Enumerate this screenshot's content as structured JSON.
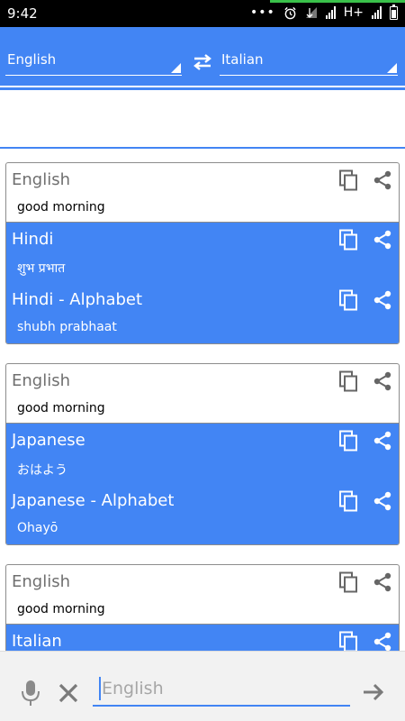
{
  "status_bar": {
    "time": "9:42",
    "network": "H+",
    "icons": [
      "dots-icon",
      "alarm-icon",
      "signal-off-icon",
      "signal-icon",
      "signal-icon",
      "battery-icon"
    ]
  },
  "colors": {
    "accent": "#4285f4",
    "status_bar": "#000000",
    "progress": "#3ac14a"
  },
  "header": {
    "source_language": "English",
    "target_language": "Italian"
  },
  "cards": [
    {
      "source": {
        "language": "English",
        "text": "good morning"
      },
      "translations": [
        {
          "language": "Hindi",
          "text": "शुभ प्रभात"
        },
        {
          "language": "Hindi - Alphabet",
          "text": "shubh prabhaat"
        }
      ]
    },
    {
      "source": {
        "language": "English",
        "text": "good morning"
      },
      "translations": [
        {
          "language": "Japanese",
          "text": "おはよう"
        },
        {
          "language": "Japanese - Alphabet",
          "text": "Ohayō"
        }
      ]
    },
    {
      "source": {
        "language": "English",
        "text": "good morning"
      },
      "translations": [
        {
          "language": "Italian",
          "text": ""
        }
      ]
    }
  ],
  "input_bar": {
    "placeholder": "English",
    "value": ""
  }
}
